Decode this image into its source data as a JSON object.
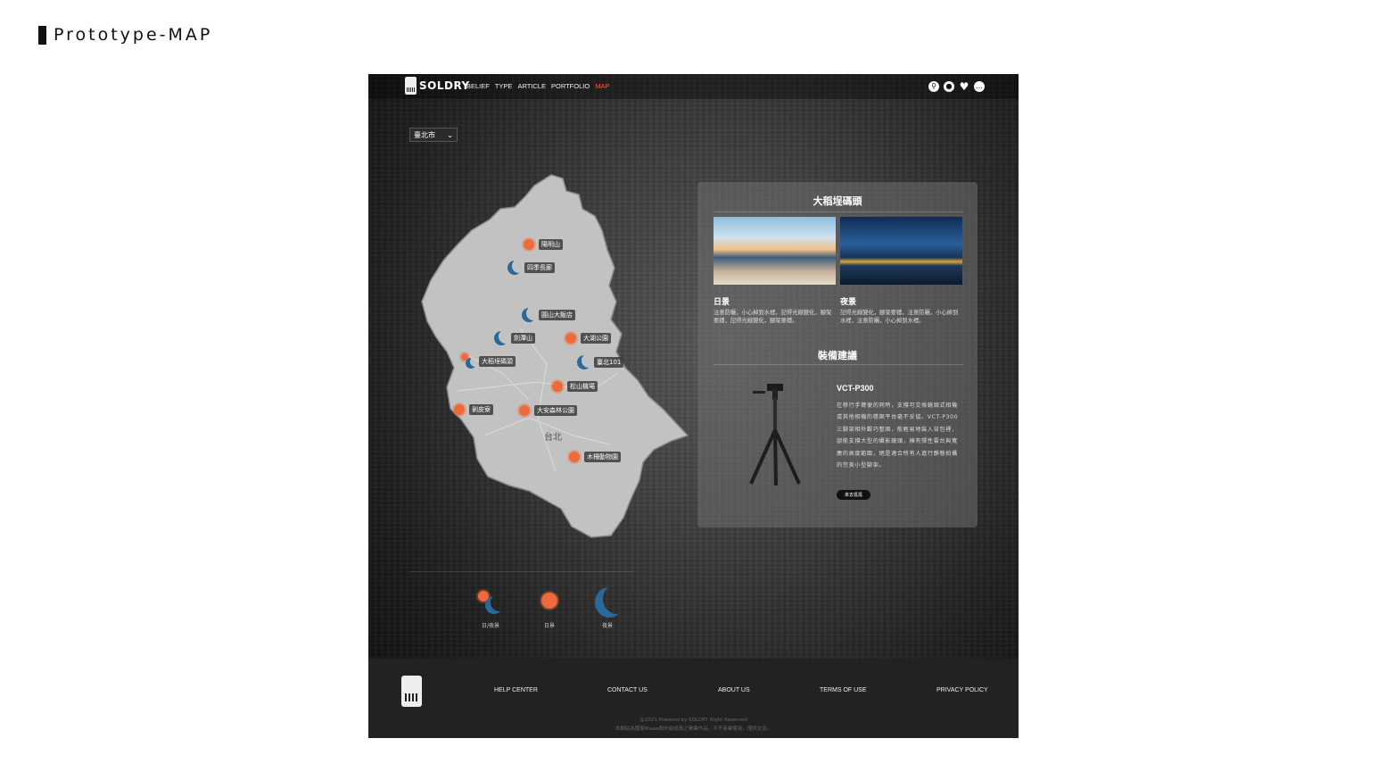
{
  "slide": {
    "title": "Prototype-MAP"
  },
  "nav": {
    "brand": "SOLDRY",
    "menu": [
      {
        "label": "BELIEF"
      },
      {
        "label": "TYPE"
      },
      {
        "label": "ARTICLE"
      },
      {
        "label": "PORTFOLIO"
      },
      {
        "label": "MAP",
        "active": true
      }
    ],
    "icons": [
      "search-icon",
      "user-icon",
      "heart-icon",
      "chat-icon"
    ],
    "accent_color": "#ff5a2a"
  },
  "city_select": {
    "selected": "臺北市"
  },
  "map": {
    "city_label": "台北",
    "markers": [
      {
        "label": "陽明山",
        "type": "day"
      },
      {
        "label": "四季長廊",
        "type": "night"
      },
      {
        "label": "圓山大飯店",
        "type": "night"
      },
      {
        "label": "劍潭山",
        "type": "night"
      },
      {
        "label": "大湖公園",
        "type": "day"
      },
      {
        "label": "大稻埕碼頭",
        "type": "both"
      },
      {
        "label": "臺北101",
        "type": "night"
      },
      {
        "label": "松山機場",
        "type": "day"
      },
      {
        "label": "剝皮寮",
        "type": "day"
      },
      {
        "label": "大安森林公園",
        "type": "day"
      },
      {
        "label": "木柵動物園",
        "type": "day"
      }
    ]
  },
  "panel": {
    "title": "大稻埕碼頭",
    "day": {
      "caption": "日景",
      "desc": "注意防曬，小心掉到水裡，記得光線變化，腳架要穩，記得光線變化，腳架要穩。"
    },
    "night": {
      "caption": "夜景",
      "desc": "記得光線變化，腳架要穩，注意防曬，小心掉到水裡，注意防曬，小心掉到水裡。"
    },
    "gear_title": "裝備建議",
    "product": {
      "name": "VCT-P300",
      "desc": "在移行手臂便的同時，支撐可交換鏡頭式相機或其他相機的穩固平台毫不妥協。VCT-P300 三腳架相外觀巧整固，能輕易地裝入背包裡，卻能支撐大型的攝影鏡頭，擁有彈性雲台與寬廣的高度範圍，絕是適合所有人進行靜態拍攝的完美小型腳架。",
      "button": "來去逛逛"
    }
  },
  "legend": [
    {
      "label": "日/夜景",
      "type": "both"
    },
    {
      "label": "日景",
      "type": "day"
    },
    {
      "label": "夜景",
      "type": "night"
    }
  ],
  "colors": {
    "day": "#ef6a3a",
    "night": "#2a6a9a"
  },
  "footer": {
    "links": [
      "HELP CENTER",
      "CONTACT US",
      "ABOUT US",
      "TERMS OF USE",
      "PRIVACY POLICY"
    ],
    "copyright": "@2021 Powered by SOLDRY Right Reserved",
    "notice": "本網站為國家Maaw設計組成員之畢業作品，不予商業使用，僅供交流。"
  }
}
